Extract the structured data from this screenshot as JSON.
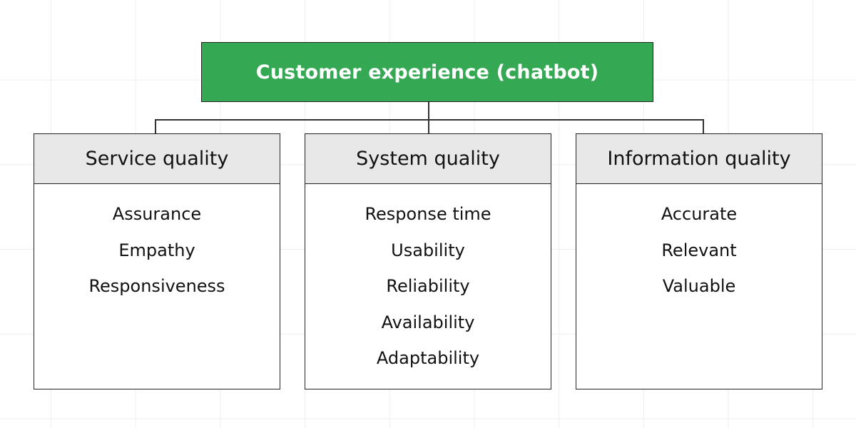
{
  "root": {
    "label": "Customer experience (chatbot)",
    "color": "#34a853"
  },
  "categories": [
    {
      "title": "Service quality",
      "items": [
        "Assurance",
        "Empathy",
        "Responsiveness"
      ]
    },
    {
      "title": "System quality",
      "items": [
        "Response time",
        "Usability",
        "Reliability",
        "Availability",
        "Adaptability"
      ]
    },
    {
      "title": "Information quality",
      "items": [
        "Accurate",
        "Relevant",
        "Valuable"
      ]
    }
  ]
}
